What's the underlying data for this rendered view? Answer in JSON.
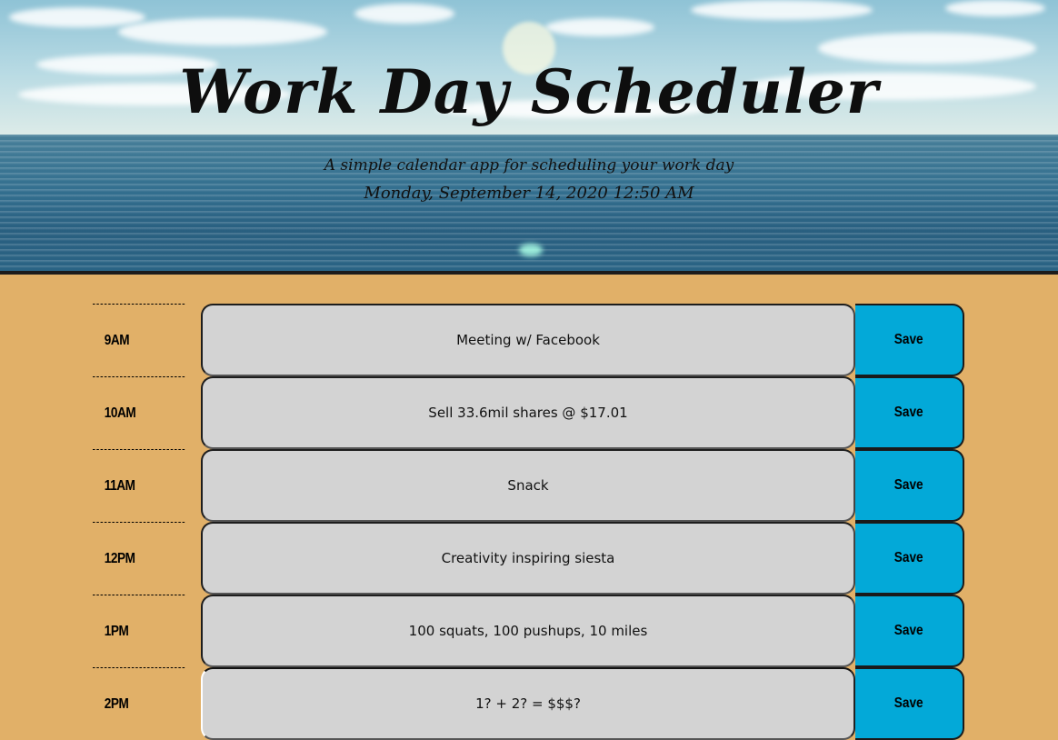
{
  "header": {
    "title": "Work Day Scheduler",
    "subtitle": "A simple calendar app for scheduling your work day",
    "current_datetime": "Monday, September 14, 2020 12:50 AM"
  },
  "schedule": {
    "rows": [
      {
        "hour": "9AM",
        "task": "Meeting w/ Facebook",
        "save_label": "Save"
      },
      {
        "hour": "10AM",
        "task": "Sell 33.6mil shares @ $17.01",
        "save_label": "Save"
      },
      {
        "hour": "11AM",
        "task": "Snack",
        "save_label": "Save"
      },
      {
        "hour": "12PM",
        "task": "Creativity inspiring siesta",
        "save_label": "Save"
      },
      {
        "hour": "1PM",
        "task": "100 squats, 100 pushups, 10 miles",
        "save_label": "Save"
      },
      {
        "hour": "2PM",
        "task": "1? + 2? = $$$?",
        "save_label": "Save"
      }
    ]
  },
  "colors": {
    "background": "#e1b068",
    "task_background": "#d3d3d3",
    "save_button": "#03a9d8"
  }
}
